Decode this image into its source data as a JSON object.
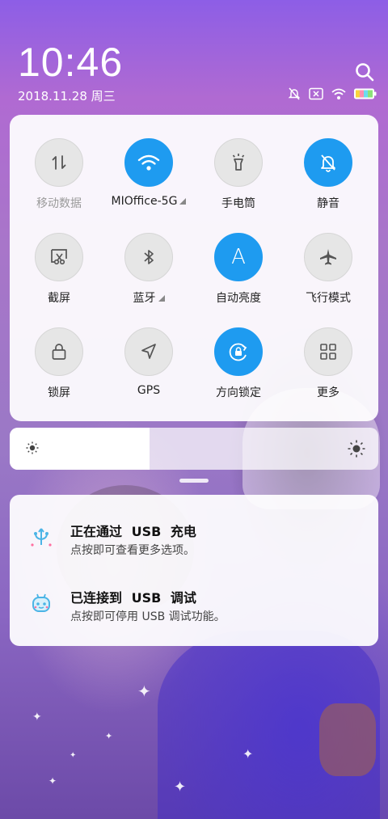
{
  "status": {
    "time": "10:46",
    "date": "2018.11.28 周三"
  },
  "icons": {
    "search": "search-icon",
    "mute": "bell-off-icon",
    "no_sim": "no-sim-icon",
    "wifi": "wifi-icon",
    "battery": "battery-icon"
  },
  "quick_settings": {
    "tiles": [
      {
        "label": "移动数据",
        "icon": "mobile-data-icon",
        "active": false
      },
      {
        "label": "MIOffice-5G",
        "icon": "wifi-icon",
        "active": true
      },
      {
        "label": "手电筒",
        "icon": "flashlight-icon",
        "active": false
      },
      {
        "label": "静音",
        "icon": "bell-off-icon",
        "active": true
      },
      {
        "label": "截屏",
        "icon": "screenshot-icon",
        "active": false
      },
      {
        "label": "蓝牙",
        "icon": "bluetooth-icon",
        "active": false
      },
      {
        "label": "自动亮度",
        "icon": "auto-brightness-icon",
        "active": true
      },
      {
        "label": "飞行模式",
        "icon": "airplane-icon",
        "active": false
      },
      {
        "label": "锁屏",
        "icon": "lock-icon",
        "active": false
      },
      {
        "label": "GPS",
        "icon": "location-arrow-icon",
        "active": false
      },
      {
        "label": "方向锁定",
        "icon": "rotation-lock-icon",
        "active": true
      },
      {
        "label": "更多",
        "icon": "grid-icon",
        "active": false
      }
    ]
  },
  "brightness": {
    "level": 0.38
  },
  "notifications": [
    {
      "title": "正在通过 USB 充电",
      "subtitle": "点按即可查看更多选项。",
      "icon": "usb-charge-icon"
    },
    {
      "title": "已连接到 USB 调试",
      "subtitle": "点按即可停用 USB 调试功能。",
      "icon": "usb-debug-icon"
    }
  ],
  "colors": {
    "accent": "#1e9bf0",
    "tile_off": "#e6e6e6",
    "panel": "#ffffff"
  }
}
